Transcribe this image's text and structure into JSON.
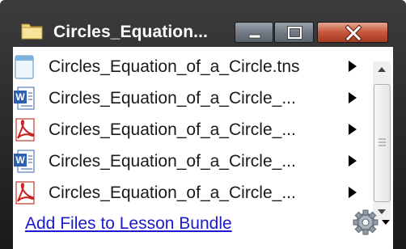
{
  "window": {
    "title": "Circles_Equation...",
    "title_icon": "folder-icon",
    "controls": {
      "minimize": "minimize-icon",
      "maximize": "maximize-icon",
      "close": "close-icon"
    }
  },
  "files": [
    {
      "name": "Circles_Equation_of_a_Circle.tns",
      "icon": "tns-file-icon"
    },
    {
      "name": "Circles_Equation_of_a_Circle_...",
      "icon": "word-file-icon"
    },
    {
      "name": "Circles_Equation_of_a_Circle_...",
      "icon": "pdf-file-icon"
    },
    {
      "name": "Circles_Equation_of_a_Circle_...",
      "icon": "word-file-icon"
    },
    {
      "name": "Circles_Equation_of_a_Circle_...",
      "icon": "pdf-file-icon"
    }
  ],
  "footer": {
    "add_files_link": "Add Files to Lesson Bundle",
    "settings_icon": "gear-icon"
  },
  "colors": {
    "titlebar": "#2a2a2a",
    "close_button": "#c4573d",
    "link": "#1a1ad0"
  }
}
